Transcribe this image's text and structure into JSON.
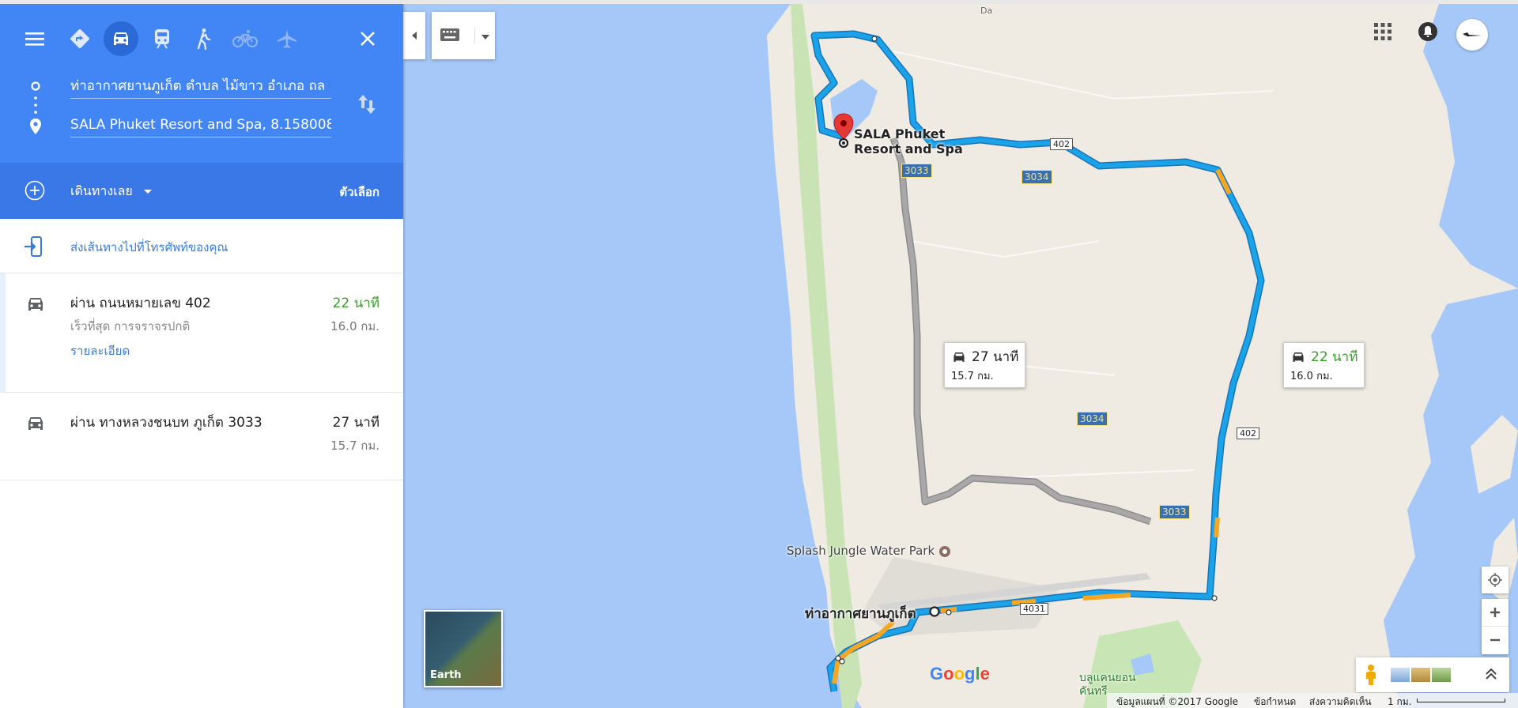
{
  "modes": {
    "menu": "menu-icon",
    "best": "diamond-directions-icon",
    "driving": "car-icon",
    "transit": "train-icon",
    "walking": "walk-icon",
    "cycling": "bicycle-icon",
    "flight": "plane-icon",
    "close": "close-icon"
  },
  "directions": {
    "origin": "ท่าอากาศยานภูเก็ต ตำบล ไม้ขาว อำเภอ ถล",
    "destination": "SALA Phuket Resort and Spa, 8.158008",
    "depart_label": "เดินทางเลย",
    "options_label": "ตัวเลือก",
    "send_to_phone": "ส่งเส้นทางไปที่โทรศัพท์ของคุณ"
  },
  "routes": [
    {
      "name": "ผ่าน ถนนหมายเลข 402",
      "time": "22 นาที",
      "distance": "16.0 กม.",
      "subtitle": "เร็วที่สุด การจราจรปกติ",
      "details": "รายละเอียด",
      "time_color": "#3a9c2a"
    },
    {
      "name": "ผ่าน ทางหลวงชนบท ภูเก็ต 3033",
      "time": "27 นาที",
      "distance": "15.7 กม.",
      "time_color": "#222222"
    }
  ],
  "map": {
    "destination_label_line1": "SALA Phuket",
    "destination_label_line2": "Resort and Spa",
    "origin_label": "ท่าอากาศยานภูเก็ต",
    "poi_label": "Splash Jungle Water Park",
    "area_label_line1": "บลูแคนยอน",
    "area_label_line2": "คันทรี",
    "road_labels": [
      "3033",
      "3034",
      "402",
      "3034",
      "402",
      "3033",
      "4031"
    ],
    "callout_a": {
      "time": "27 นาที",
      "distance": "15.7 กม."
    },
    "callout_b": {
      "time": "22 นาที",
      "distance": "16.0 กม."
    },
    "top_label": "Da",
    "earth_label": "Earth",
    "google": "Google",
    "footer": {
      "map_data": "ข้อมูลแผนที่ ©2017 Google",
      "terms": "ข้อกำหนด",
      "feedback": "ส่งความคิดเห็น",
      "scale": "1 กม."
    },
    "colors": {
      "route_primary": "#1aa3e8",
      "route_alt": "#a0a0a0",
      "traffic": "#f5a623",
      "water": "#a5c8f8",
      "land": "#efebe3"
    }
  }
}
